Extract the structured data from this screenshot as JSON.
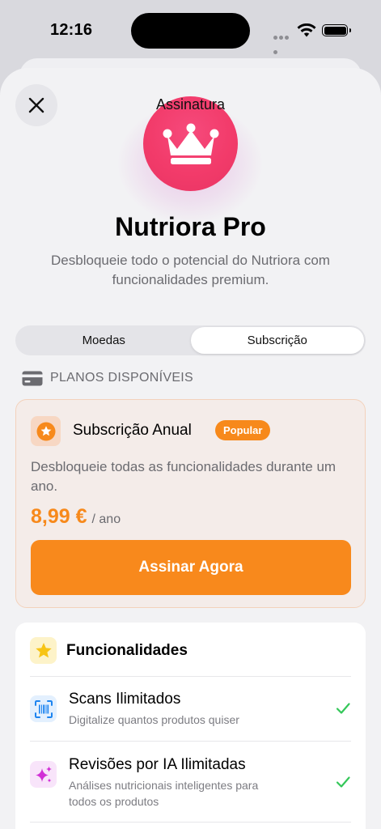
{
  "status": {
    "time": "12:16"
  },
  "sheet": {
    "title": "Assinatura"
  },
  "hero": {
    "name": "Nutriora Pro",
    "description": "Desbloqueie todo o potencial do Nutriora com funcionalidades premium."
  },
  "segments": [
    {
      "label": "Moedas",
      "selected": false
    },
    {
      "label": "Subscrição",
      "selected": true
    }
  ],
  "plans_header": "PLANOS DISPONÍVEIS",
  "plan": {
    "name": "Subscrição Anual",
    "badge": "Popular",
    "description": "Desbloqueie todas as funcionalidades durante um ano.",
    "price": "8,99 €",
    "period": "/ ano",
    "cta": "Assinar Agora"
  },
  "features": {
    "title": "Funcionalidades",
    "items": [
      {
        "title": "Scans Ilimitados",
        "subtitle": "Digitalize quantos produtos quiser",
        "icon": "barcode-scan-icon"
      },
      {
        "title": "Revisões por IA Ilimitadas",
        "subtitle": "Análises nutricionais inteligentes para todos os produtos",
        "icon": "sparkles-icon"
      }
    ]
  },
  "colors": {
    "accent": "#F8891C",
    "crown": "#F23B6A",
    "check": "#34C759"
  }
}
